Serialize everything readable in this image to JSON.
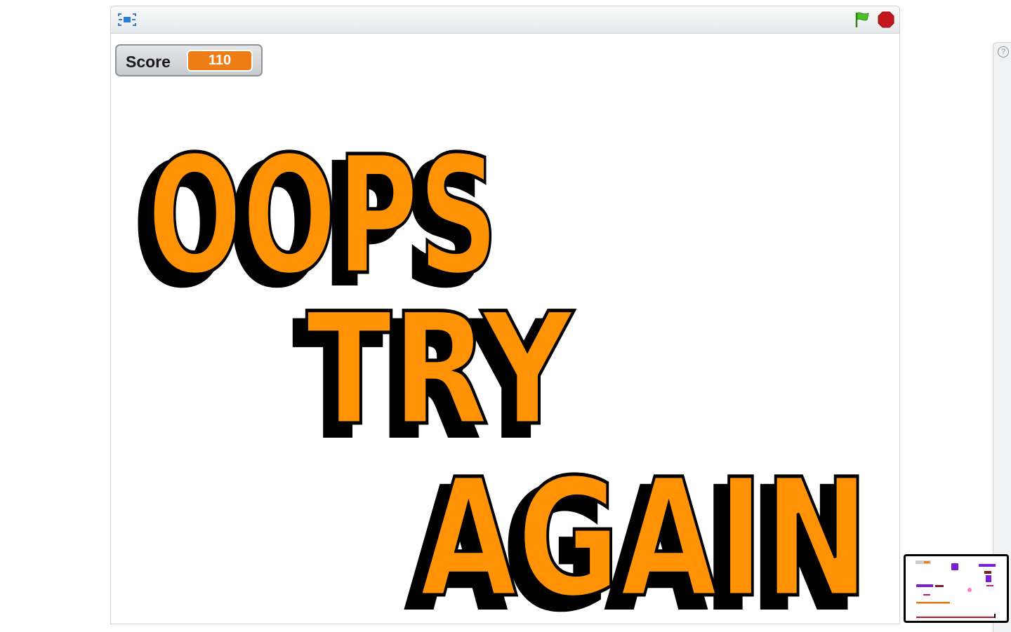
{
  "toolbar": {
    "fullscreen_icon": "fullscreen-icon",
    "flag_icon": "green-flag-icon",
    "stop_icon": "stop-icon",
    "flag_color": "#4cbf24",
    "stop_color": "#c4161c"
  },
  "monitor": {
    "label": "Score",
    "value": "110",
    "value_color": "#ee7d16"
  },
  "game_over": {
    "line1": "OOPS",
    "line2": "TRY",
    "line3": "AGAIN",
    "fill_color": "#ff9305",
    "outline_color": "#000000"
  },
  "side_panel": {
    "help_label": "?"
  }
}
